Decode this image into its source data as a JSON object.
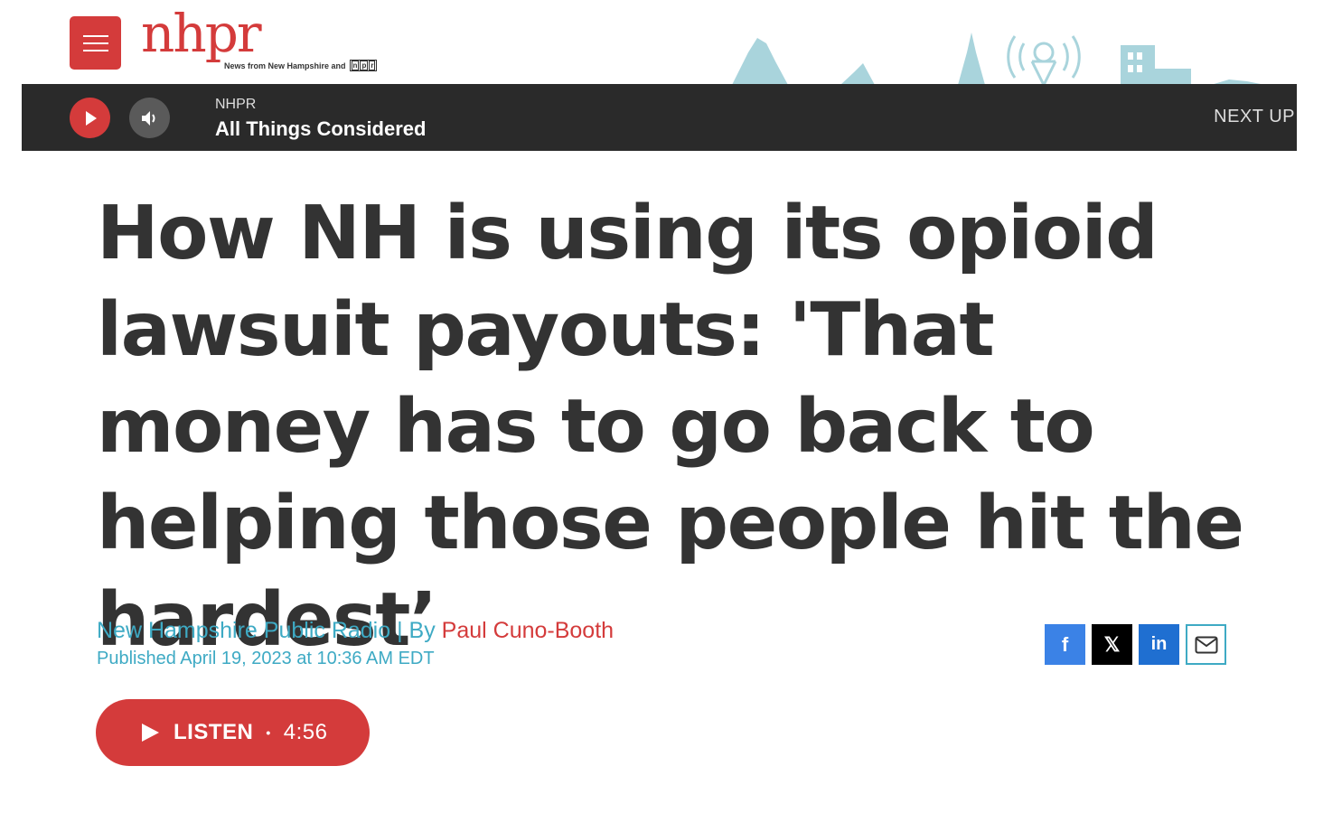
{
  "header": {
    "logo_text": "nhpr",
    "tagline": "News from New Hampshire and",
    "npr_letters": [
      "n",
      "p",
      "r"
    ],
    "brand_color": "#d43b3b",
    "skyline_color": "#a9d4dc"
  },
  "player": {
    "station": "NHPR",
    "show": "All Things Considered",
    "next_up": "NEXT UP"
  },
  "article": {
    "headline": "How NH is using its opioid lawsuit payouts: 'That money has to go back to helping those people hit the hardest’",
    "org": "New Hampshire Public Radio",
    "by_separator": " | By ",
    "author": "Paul Cuno-Booth",
    "published": "Published April 19, 2023 at 10:36 AM EDT"
  },
  "share": {
    "facebook_icon": "f",
    "x_icon": "𝕏",
    "linkedin_icon": "in",
    "email_icon": "envelope-icon"
  },
  "listen": {
    "label": "LISTEN",
    "separator": "•",
    "duration": "4:56"
  }
}
